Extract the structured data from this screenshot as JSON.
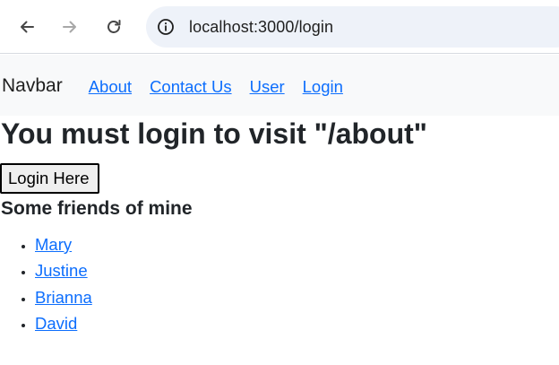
{
  "browser": {
    "url": "localhost:3000/login",
    "icons": {
      "back": "back-arrow-icon",
      "forward": "forward-arrow-icon",
      "reload": "reload-icon",
      "site_info": "info-icon"
    }
  },
  "navbar": {
    "brand": "Navbar",
    "links": [
      {
        "label": "About"
      },
      {
        "label": "Contact Us"
      },
      {
        "label": "User"
      },
      {
        "label": "Login"
      }
    ],
    "link_color": "#0d6efd",
    "background": "#f8f9fa"
  },
  "main": {
    "heading": "You must login to visit \"/about\"",
    "login_button": "Login Here",
    "friends_heading": "Some friends of mine",
    "friends": [
      {
        "name": "Mary"
      },
      {
        "name": "Justine"
      },
      {
        "name": "Brianna"
      },
      {
        "name": "David"
      }
    ]
  }
}
